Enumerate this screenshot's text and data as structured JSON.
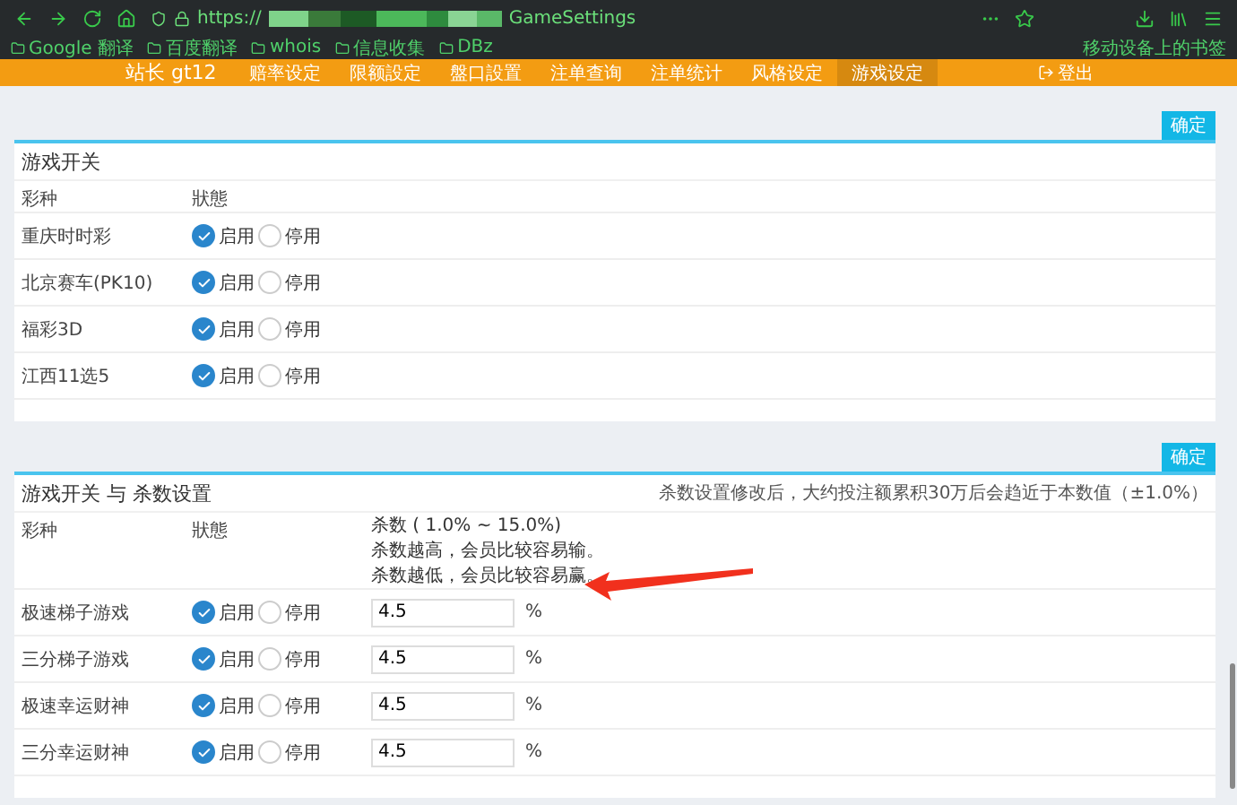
{
  "browser": {
    "url_prefix": "https://",
    "url_suffix": "GameSettings",
    "bookmarks": [
      "Google 翻译",
      "百度翻译",
      "whois",
      "信息收集",
      "DBz"
    ],
    "mobile_bookmarks": "移动设备上的书签"
  },
  "nav": {
    "brand": "站长 gt12",
    "items": [
      {
        "label": "赔率设定",
        "selected": false
      },
      {
        "label": "限额設定",
        "selected": false
      },
      {
        "label": "盤口設置",
        "selected": false
      },
      {
        "label": "注单查询",
        "selected": false
      },
      {
        "label": "注单统计",
        "selected": false
      },
      {
        "label": "风格设定",
        "selected": false
      },
      {
        "label": "游戏设定",
        "selected": true
      }
    ],
    "logout": "登出"
  },
  "sections": [
    {
      "confirm": "确定",
      "title": "游戏开关",
      "columns": [
        "彩种",
        "狀態"
      ],
      "rows": [
        {
          "name": "重庆时时彩",
          "options": [
            {
              "label": "启用",
              "selected": true
            },
            {
              "label": "停用",
              "selected": false
            }
          ]
        },
        {
          "name": "北京赛车(PK10)",
          "options": [
            {
              "label": "启用",
              "selected": true
            },
            {
              "label": "停用",
              "selected": false
            }
          ]
        },
        {
          "name": "福彩3D",
          "options": [
            {
              "label": "启用",
              "selected": true
            },
            {
              "label": "停用",
              "selected": false
            }
          ]
        },
        {
          "name": "江西11选5",
          "options": [
            {
              "label": "启用",
              "selected": true
            },
            {
              "label": "停用",
              "selected": false
            }
          ]
        }
      ]
    },
    {
      "confirm": "确定",
      "title": "游戏开关 与 杀数设置",
      "note": "杀数设置修改后，大约投注额累积30万后会趋近于本数值（±1.0%）",
      "columns": [
        "彩种",
        "狀態"
      ],
      "kill_header": [
        "杀数 ( 1.0% ~ 15.0%)",
        "杀数越高，会员比较容易输。",
        "杀数越低，会员比较容易赢。"
      ],
      "rows": [
        {
          "name": "极速梯子游戏",
          "options": [
            {
              "label": "启用",
              "selected": true
            },
            {
              "label": "停用",
              "selected": false
            }
          ],
          "kill": "4.5",
          "unit": "%"
        },
        {
          "name": "三分梯子游戏",
          "options": [
            {
              "label": "启用",
              "selected": true
            },
            {
              "label": "停用",
              "selected": false
            }
          ],
          "kill": "4.5",
          "unit": "%"
        },
        {
          "name": "极速幸运财神",
          "options": [
            {
              "label": "启用",
              "selected": true
            },
            {
              "label": "停用",
              "selected": false
            }
          ],
          "kill": "4.5",
          "unit": "%"
        },
        {
          "name": "三分幸运财神",
          "options": [
            {
              "label": "启用",
              "selected": true
            },
            {
              "label": "停用",
              "selected": false
            }
          ],
          "kill": "4.5",
          "unit": "%"
        }
      ]
    }
  ]
}
